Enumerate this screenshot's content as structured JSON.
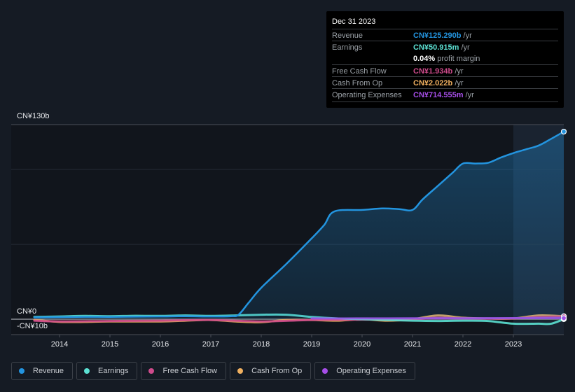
{
  "tooltip": {
    "date": "Dec 31 2023",
    "rows": [
      {
        "label": "Revenue",
        "value": "CN¥125.290b",
        "unit": " /yr",
        "color": "#2394df"
      },
      {
        "label": "Earnings",
        "value": "CN¥50.915m",
        "unit": " /yr",
        "color": "#5ce1d3"
      },
      {
        "label": "",
        "value": "0.04%",
        "unit": " profit margin",
        "color": "#ffffff"
      },
      {
        "label": "Free Cash Flow",
        "value": "CN¥1.934b",
        "unit": " /yr",
        "color": "#cf4b8c"
      },
      {
        "label": "Cash From Op",
        "value": "CN¥2.022b",
        "unit": " /yr",
        "color": "#f0b060"
      },
      {
        "label": "Operating Expenses",
        "value": "CN¥714.555m",
        "unit": " /yr",
        "color": "#a64ee8"
      }
    ]
  },
  "legend": [
    {
      "label": "Revenue",
      "color": "#2394df"
    },
    {
      "label": "Earnings",
      "color": "#5ce1d3"
    },
    {
      "label": "Free Cash Flow",
      "color": "#cf4b8c"
    },
    {
      "label": "Cash From Op",
      "color": "#f0b060"
    },
    {
      "label": "Operating Expenses",
      "color": "#a64ee8"
    }
  ],
  "chart_data": {
    "type": "line",
    "title": "",
    "xlabel": "",
    "ylabel": "",
    "y_top_label": "CN¥130b",
    "y_zero_label": "CN¥0",
    "y_bottom_label": "-CN¥10b",
    "ylim": [
      -10,
      130
    ],
    "xlim": [
      2013.25,
      2024.0
    ],
    "x_ticks": [
      "2014",
      "2015",
      "2016",
      "2017",
      "2018",
      "2019",
      "2020",
      "2021",
      "2022",
      "2023"
    ],
    "highlight_from": 2023.0,
    "grid": true,
    "legend_position": "bottom",
    "series": [
      {
        "name": "Revenue",
        "color": "#2394df",
        "fill": true,
        "x": [
          2013.5,
          2014.0,
          2014.5,
          2015.0,
          2015.5,
          2016.0,
          2016.5,
          2017.0,
          2017.4,
          2017.55,
          2017.75,
          2018.0,
          2018.5,
          2019.0,
          2019.25,
          2019.45,
          2020.0,
          2020.4,
          2020.75,
          2021.0,
          2021.2,
          2021.5,
          2021.8,
          2022.0,
          2022.25,
          2022.5,
          2022.75,
          2023.0,
          2023.25,
          2023.5,
          2023.75,
          2024.0
        ],
        "y": [
          1.2,
          1.4,
          1.6,
          1.5,
          1.7,
          1.8,
          2.0,
          1.8,
          2.0,
          3.0,
          11.0,
          21.0,
          37.0,
          54.0,
          63.0,
          72.0,
          73.0,
          74.0,
          73.5,
          73.0,
          80.0,
          89.0,
          98.0,
          104.0,
          104.0,
          104.5,
          108.0,
          111.0,
          113.5,
          116.0,
          120.5,
          125.3
        ]
      },
      {
        "name": "Earnings",
        "color": "#5ce1d3",
        "x": [
          2013.5,
          2014.0,
          2014.5,
          2015.0,
          2015.5,
          2016.0,
          2016.5,
          2017.0,
          2017.5,
          2018.0,
          2018.5,
          2019.0,
          2019.5,
          2020.0,
          2020.5,
          2021.0,
          2021.5,
          2022.0,
          2022.5,
          2023.0,
          2023.5,
          2023.75,
          2024.0
        ],
        "y": [
          1.5,
          1.8,
          2.2,
          2.0,
          2.3,
          2.2,
          2.5,
          2.2,
          2.5,
          3.0,
          3.0,
          1.5,
          0.5,
          0.0,
          -0.5,
          -1.0,
          -1.2,
          -1.0,
          -1.2,
          -3.0,
          -3.0,
          -3.0,
          0.05
        ]
      },
      {
        "name": "Free Cash Flow",
        "color": "#cf4b8c",
        "x": [
          2013.5,
          2014.0,
          2015.0,
          2016.0,
          2017.0,
          2018.0,
          2019.0,
          2020.0,
          2021.0,
          2021.5,
          2022.0,
          2023.0,
          2023.5,
          2024.0
        ],
        "y": [
          -1.0,
          -1.5,
          -1.2,
          -1.0,
          -0.5,
          -1.5,
          -0.5,
          -0.3,
          0.0,
          1.0,
          0.5,
          0.5,
          1.5,
          1.9
        ]
      },
      {
        "name": "Cash From Op",
        "color": "#f0b060",
        "x": [
          2013.5,
          2014.0,
          2014.5,
          2015.0,
          2016.0,
          2016.5,
          2017.0,
          2017.5,
          2018.0,
          2018.5,
          2019.0,
          2019.5,
          2020.0,
          2020.5,
          2021.0,
          2021.5,
          2022.0,
          2022.5,
          2023.0,
          2023.5,
          2024.0
        ],
        "y": [
          -0.5,
          -1.8,
          -1.8,
          -1.5,
          -1.5,
          -1.0,
          -0.5,
          -1.5,
          -2.0,
          -0.5,
          -0.5,
          -1.0,
          0.0,
          -1.0,
          0.0,
          2.5,
          1.0,
          0.5,
          0.5,
          2.5,
          2.0
        ]
      },
      {
        "name": "Operating Expenses",
        "color": "#a64ee8",
        "x": [
          2019.0,
          2020.0,
          2021.0,
          2022.0,
          2023.0,
          2024.0
        ],
        "y": [
          0.5,
          0.5,
          0.6,
          0.6,
          0.7,
          0.71
        ]
      }
    ]
  }
}
